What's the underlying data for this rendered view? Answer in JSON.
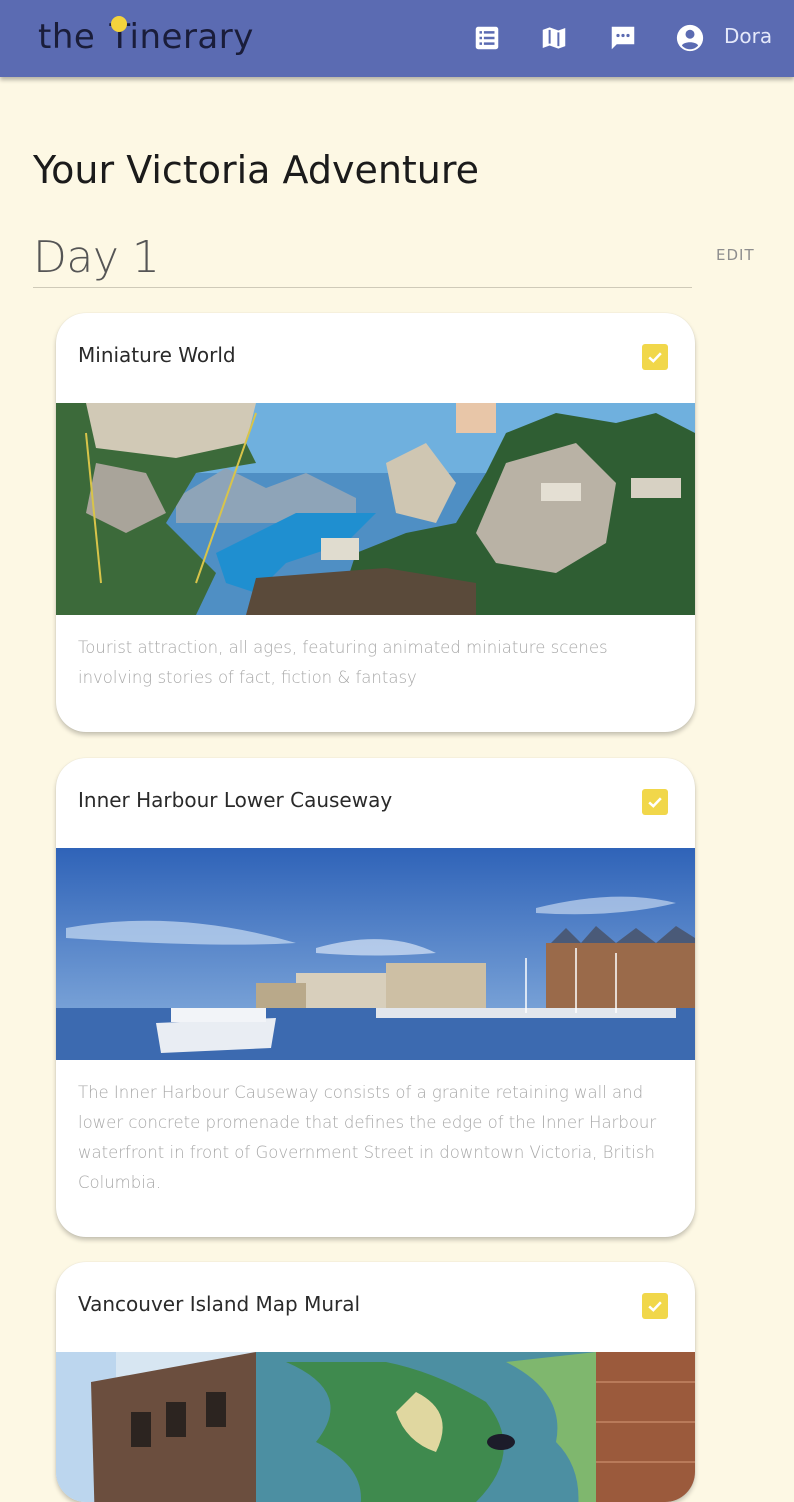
{
  "header": {
    "logo_text_left": "the",
    "logo_text_right": "Tinerary",
    "nav_icons": [
      "list-icon",
      "map-icon",
      "chat-icon",
      "account-icon"
    ],
    "user_name": "Dora",
    "accent_color": "#5b6bb2",
    "logo_dot_color": "#f4d33c"
  },
  "page": {
    "title": "Your Victoria Adventure",
    "background_color": "#fdf8e4"
  },
  "day": {
    "title": "Day 1",
    "edit_label": "EDIT"
  },
  "activities": [
    {
      "title": "Miniature World",
      "checked": true,
      "image": "miniature-diorama-image",
      "description": "Tourist attraction, all ages, featuring animated miniature scenes involving stories of fact, fiction & fantasy"
    },
    {
      "title": "Inner Harbour Lower Causeway",
      "checked": true,
      "image": "harbour-panorama-image",
      "description": "The Inner Harbour Causeway consists of a granite retaining wall and lower concrete promenade that defines the edge of the Inner Harbour waterfront in front of Government Street in downtown Victoria, British Columbia."
    },
    {
      "title": "Vancouver Island Map Mural",
      "checked": true,
      "image": "map-mural-image"
    }
  ],
  "checkbox_color": "#f1d74a"
}
